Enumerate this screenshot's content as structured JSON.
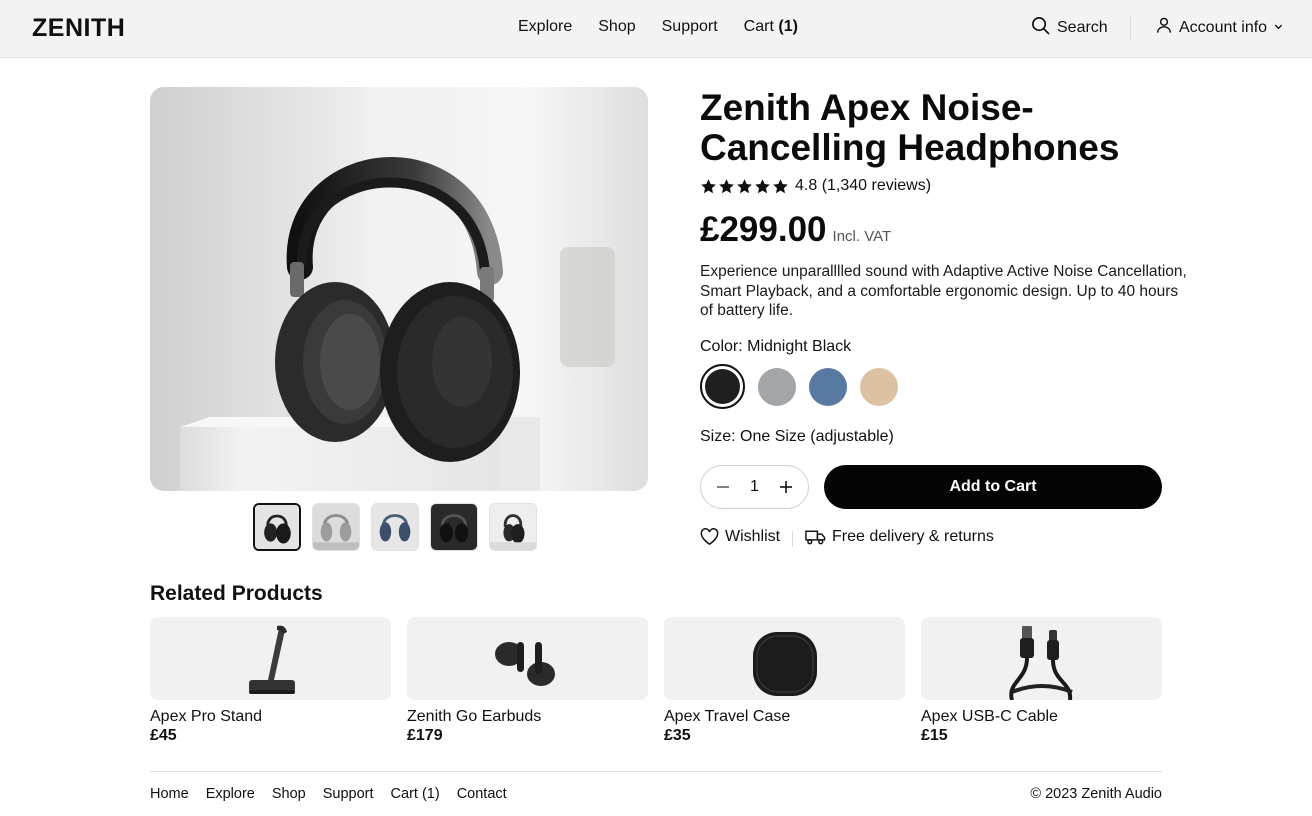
{
  "header": {
    "logo": "ZENITH",
    "nav": [
      {
        "label": "Explore"
      },
      {
        "label": "Shop"
      },
      {
        "label": "Support"
      }
    ],
    "cart_label": "Cart",
    "cart_count": "(1)",
    "search_label": "Search",
    "account_label": "Account info"
  },
  "product": {
    "title": "Zenith Apex Noise-Cancelling Headphones",
    "rating_value": 4.8,
    "rating_text": "4.8 (1,340 reviews)",
    "price": "£299.00",
    "vat": "Incl. VAT",
    "description": "Experience unparalllled sound with Adaptive Active Noise Cancellation, Smart Playback, and a comfortable ergonomic design. Up to 40 hours of battery life.",
    "color_label": "Color: Midnight Black",
    "swatches": [
      {
        "color": "#1f1f1f",
        "selected": true
      },
      {
        "color": "#a3a6a9",
        "selected": false
      },
      {
        "color": "#587aa1",
        "selected": false
      },
      {
        "color": "#dcc2a3",
        "selected": false
      }
    ],
    "size_label": "Size: One Size (adjustable)",
    "quantity": "1",
    "add_to_cart": "Add to Cart",
    "wishlist": "Wishlist",
    "delivery": "Free delivery & returns",
    "thumbnail_count": 5
  },
  "related": {
    "title": "Related Products",
    "items": [
      {
        "name": "Apex Pro Stand",
        "price": "£45",
        "icon": "stand-icon"
      },
      {
        "name": "Zenith Go Earbuds",
        "price": "£179",
        "icon": "earbuds-icon"
      },
      {
        "name": "Apex Travel Case",
        "price": "£35",
        "icon": "case-icon"
      },
      {
        "name": "Apex USB-C Cable",
        "price": "£15",
        "icon": "cable-icon"
      }
    ]
  },
  "footer": {
    "links": [
      "Home",
      "Explore",
      "Shop",
      "Support",
      "Cart (1)",
      "Contact"
    ],
    "copyright": "© 2023 Zenith Audio"
  },
  "colors": {
    "accent": "#050505",
    "header_bg": "#f3f3f3",
    "card_bg": "#f1f1f1"
  }
}
